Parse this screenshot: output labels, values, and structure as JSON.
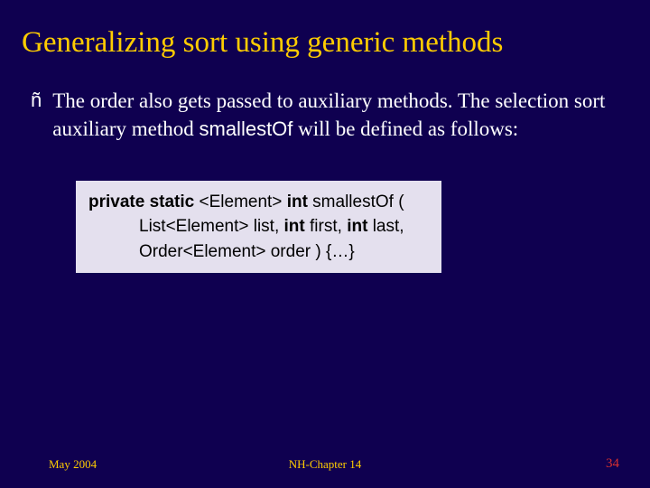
{
  "title": "Generalizing sort using generic methods",
  "bullet": {
    "mark": "ñ",
    "text_before": "The order also gets passed to auxiliary methods. The selection sort auxiliary method ",
    "method": "smallestOf",
    "text_after": " will be defined as follows:"
  },
  "code": {
    "kw_private": "private",
    "kw_static": "static",
    "generic": " <Element> ",
    "kw_int": "int",
    "sig_name": " smallestOf (",
    "line2_a": "List<Element> list, ",
    "kw_int2": "int",
    "line2_b": " first, ",
    "kw_int3": "int",
    "line2_c": " last,",
    "line3": "Order<Element> order ) {…}"
  },
  "footer": {
    "left": "May 2004",
    "center": "NH-Chapter 14",
    "right": "34"
  }
}
